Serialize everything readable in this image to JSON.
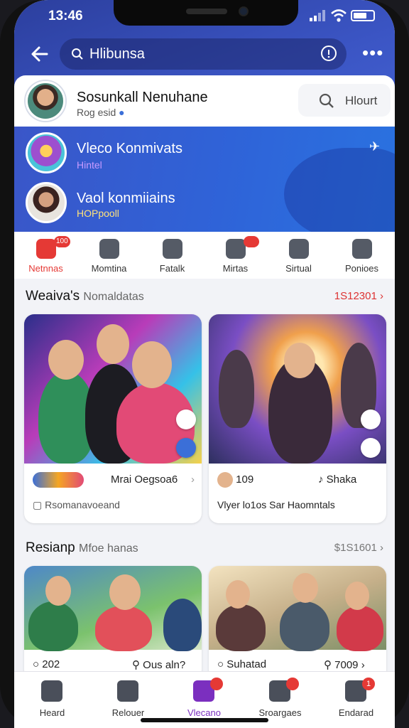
{
  "status_bar": {
    "time": "13:46"
  },
  "search": {
    "query": "Hlibunsa"
  },
  "profile": {
    "name": "Sosunkall Nenuhane",
    "subtitle": "Rog esid",
    "search_label": "Hlourt"
  },
  "groups": [
    {
      "name": "Vleco Konmivats",
      "sub": "Hintel",
      "sub_color": "#c89bff"
    },
    {
      "name": "Vaol konmiiains",
      "sub": "HOPpooll",
      "sub_color": "#ffe27a"
    }
  ],
  "categories": [
    {
      "label": "Netnnas",
      "icon": "live-icon",
      "color": "#e53935",
      "badge": "100",
      "active": true
    },
    {
      "label": "Momtina",
      "icon": "square-icon",
      "color": "#555b66"
    },
    {
      "label": "Fatalk",
      "icon": "pointer-icon",
      "color": "#555b66"
    },
    {
      "label": "Mirtas",
      "icon": "book-icon",
      "color": "#555b66",
      "badge": ""
    },
    {
      "label": "Sirtual",
      "icon": "bell-icon",
      "color": "#555b66"
    },
    {
      "label": "Ponioes",
      "icon": "flag-icon",
      "color": "#555b66"
    }
  ],
  "sections": [
    {
      "title": "Weaiva's",
      "subtitle": "Nomaldatas",
      "more": "1S12301",
      "cards": [
        {
          "row1_name": "Mrai Oegsoa6",
          "row2": "Rsomanavoeand"
        },
        {
          "row1_count": "109",
          "row1_name": "Shaka",
          "row2": "Vlyer lo1os Sar Haomntals"
        }
      ]
    },
    {
      "title": "Resianp",
      "subtitle": "Mfoe hanas",
      "more": "$1S1601",
      "cards": [
        {
          "row1_count": "202",
          "row1_name": "Ous aln?"
        },
        {
          "row1_name": "Suhatad",
          "row1_count": "7009"
        }
      ]
    }
  ],
  "tabs": [
    {
      "label": "Heard",
      "icon": "home-icon",
      "active": false
    },
    {
      "label": "Relouer",
      "icon": "search-icon",
      "active": false
    },
    {
      "label": "Vlecano",
      "icon": "video-icon",
      "active": true,
      "badge": ""
    },
    {
      "label": "Sroargaes",
      "icon": "share-icon",
      "active": false,
      "badge": ""
    },
    {
      "label": "Endarad",
      "icon": "store-icon",
      "active": false,
      "badge": "1"
    }
  ],
  "colors": {
    "accent": "#7b2fbf",
    "header_blue": "#3b55c4",
    "badge_red": "#e53935"
  }
}
